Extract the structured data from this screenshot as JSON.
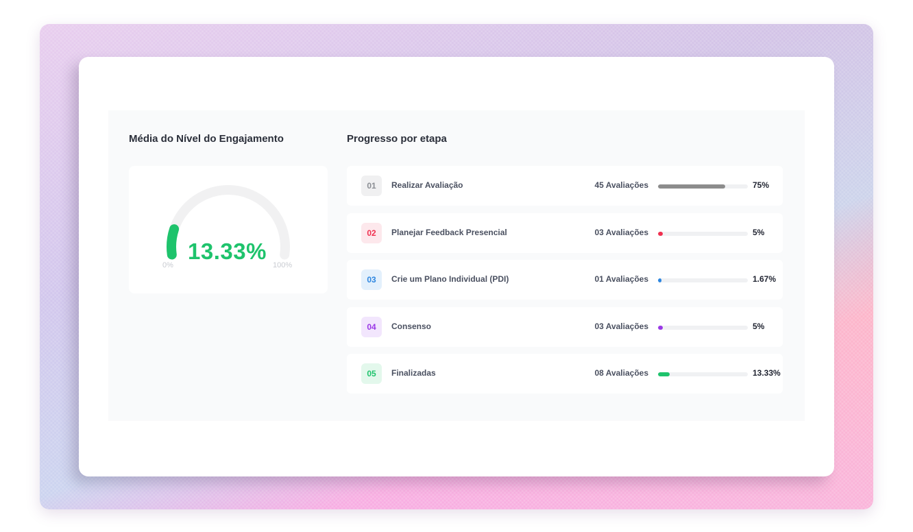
{
  "gauge": {
    "title": "Média do Nível do Engajamento",
    "value_label": "13.33%",
    "value": 13.33,
    "min_label": "0%",
    "max_label": "100%",
    "color": "#1ec36c",
    "track_color": "#f1f1f2"
  },
  "progress": {
    "title": "Progresso por etapa",
    "steps": [
      {
        "number": "01",
        "label": "Realizar Avaliação",
        "count": "45 Avaliações",
        "percent_label": "75%",
        "percent": 75,
        "color": "#8c8c8c",
        "badge_bg": "#f0f0f1",
        "badge_color": "#8a8d93"
      },
      {
        "number": "02",
        "label": "Planejar Feedback Presencial",
        "count": "03 Avaliações",
        "percent_label": "5%",
        "percent": 5,
        "color": "#f0304f",
        "badge_bg": "#fde8ec",
        "badge_color": "#f0304f"
      },
      {
        "number": "03",
        "label": "Crie um Plano Individual (PDI)",
        "count": "01 Avaliações",
        "percent_label": "1.67%",
        "percent": 1.67,
        "color": "#2d86e0",
        "badge_bg": "#e3f0fc",
        "badge_color": "#2d86e0"
      },
      {
        "number": "04",
        "label": "Consenso",
        "count": "03 Avaliações",
        "percent_label": "5%",
        "percent": 5,
        "color": "#9a38e6",
        "badge_bg": "#f2e6fd",
        "badge_color": "#9a38e6"
      },
      {
        "number": "05",
        "label": "Finalizadas",
        "count": "08 Avaliações",
        "percent_label": "13.33%",
        "percent": 13.33,
        "color": "#1ec36c",
        "badge_bg": "#e3f8ec",
        "badge_color": "#1ec36c"
      }
    ]
  }
}
